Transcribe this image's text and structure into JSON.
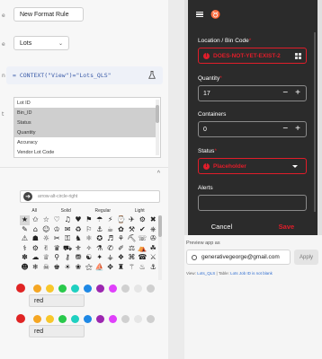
{
  "editor": {
    "name_value": "New Format Rule",
    "table_select": "Lots",
    "condition_expr": "= CONTEXT(\"View\")=\"Lots_QLS\"",
    "columns": [
      {
        "label": "Lot ID",
        "selected": false
      },
      {
        "label": "Bin_ID",
        "selected": true
      },
      {
        "label": "Status",
        "selected": true
      },
      {
        "label": "Quantity",
        "selected": true
      },
      {
        "label": "Accuracy",
        "selected": false
      },
      {
        "label": "Vendor Lot Code",
        "selected": false
      }
    ],
    "collapse_glyph": "^",
    "icon_search_value": "arrow-alt-circle-right",
    "icon_styles": [
      "All",
      "Solid",
      "Regular",
      "Light"
    ],
    "icon_glyphs": [
      "★",
      "✩",
      "☆",
      "♡",
      "♫",
      "♥",
      "⚑",
      "☂",
      "⚡",
      "⌚",
      "✈",
      "⚙",
      "✖",
      "✎",
      "⌂",
      "☺",
      "♔",
      "✉",
      "♻",
      "⚐",
      "⚓",
      "☕",
      "✿",
      "⚒",
      "✔",
      "⎈",
      "⚠",
      "☗",
      "☼",
      "✂",
      "⚿",
      "♞",
      "⚛",
      "✪",
      "♬",
      "⚘",
      "⛏",
      "☏",
      "✇",
      "⚕",
      "⚙",
      "✌",
      "♛",
      "⛟",
      "⚜",
      "✧",
      "⚗",
      "✆",
      "✐",
      "⚖",
      "⛺",
      "☘",
      "✽",
      "☁",
      "♕",
      "⚲",
      "⚷",
      "⛃",
      "☯",
      "✦",
      "⚶",
      "❖",
      "⌘",
      "☎",
      "⚔",
      "☻",
      "❄",
      "☠",
      "♚",
      "☀",
      "❀",
      "⚝",
      "⛵",
      "✥",
      "♜",
      "⚚",
      "♨",
      "⚓"
    ],
    "selected_icon_index": 0,
    "text_color_value": "red",
    "highlight_color_value": "red",
    "palette_colors": [
      "#f5a623",
      "#f8c72b",
      "#29c94b",
      "#1fd0c0",
      "#1e88e5",
      "#9c27b0",
      "#e040fb",
      "#d0d0d0",
      "#e6e6e6",
      "#cfcfcf"
    ],
    "selected_color": "#e02424"
  },
  "app": {
    "form_fields": [
      {
        "label": "Location / Bin Code",
        "required": true,
        "value": "DOES-NOT-YET-EXIST-2",
        "error": true,
        "control": "barcode"
      },
      {
        "label": "Quantity",
        "required": true,
        "value": "17",
        "error": false,
        "control": "stepper"
      },
      {
        "label": "Containers",
        "required": false,
        "value": "0",
        "error": false,
        "control": "stepper"
      },
      {
        "label": "Status",
        "required": true,
        "value": "Placeholder",
        "error": true,
        "control": "dropdown"
      },
      {
        "label": "Alerts",
        "required": false,
        "value": "",
        "error": false,
        "control": "text"
      }
    ],
    "required_marker": "*",
    "error_glyph": "!",
    "minus_glyph": "−",
    "plus_glyph": "+",
    "cancel_label": "Cancel",
    "save_label": "Save",
    "accent_color": "#e11d2a"
  },
  "preview": {
    "label": "Preview app as",
    "email": "generativegeorge@gmail.com",
    "apply_label": "Apply",
    "view_prefix": "View:",
    "view_link": "Lots_QLS",
    "separator": "|",
    "table_prefix": "Table:",
    "table_link": "Lots Job ID is not blank"
  }
}
